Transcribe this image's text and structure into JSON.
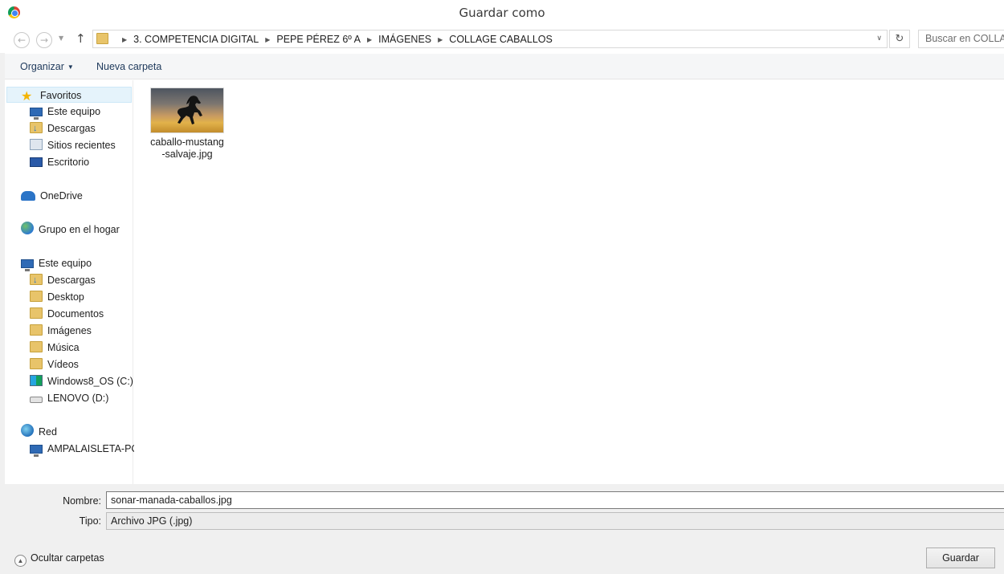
{
  "window": {
    "title": "Guardar como"
  },
  "address": {
    "crumbs": [
      "3. COMPETENCIA DIGITAL",
      "PEPE PÉREZ 6º A",
      "IMÁGENES",
      "COLLAGE CABALLOS"
    ]
  },
  "search": {
    "placeholder": "Buscar en COLLAGE CABALLOS"
  },
  "toolbar": {
    "organize_label": "Organizar",
    "new_folder_label": "Nueva carpeta"
  },
  "sidebar": {
    "favorites": "Favoritos",
    "fav_items": [
      "Este equipo",
      "Descargas",
      "Sitios recientes",
      "Escritorio"
    ],
    "onedrive": "OneDrive",
    "homegroup": "Grupo en el hogar",
    "this_pc": "Este equipo",
    "pc_items": [
      "Descargas",
      "Desktop",
      "Documentos",
      "Imágenes",
      "Música",
      "Vídeos",
      "Windows8_OS (C:)",
      "LENOVO (D:)"
    ],
    "network": "Red",
    "network_items": [
      "AMPALAISLETA-PC"
    ]
  },
  "files": [
    {
      "name": "caballo-mustang-salvaje.jpg",
      "name_line1": "caballo-mustang",
      "name_line2": "-salvaje.jpg",
      "icon": "image-thumbnail"
    }
  ],
  "form": {
    "name_label": "Nombre:",
    "name_value": "sonar-manada-caballos.jpg",
    "type_label": "Tipo:",
    "type_value": "Archivo JPG (.jpg)"
  },
  "footer": {
    "hide_folders_label": "Ocultar carpetas",
    "save_label": "Guardar"
  }
}
